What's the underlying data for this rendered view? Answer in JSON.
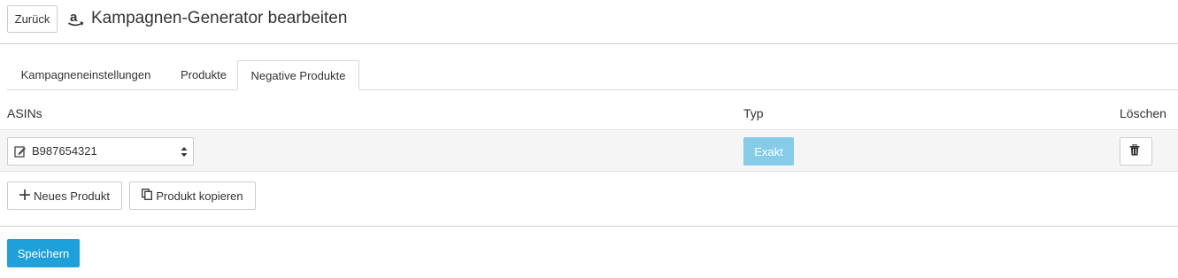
{
  "header": {
    "back_label": "Zurück",
    "title": "Kampagnen-Generator bearbeiten",
    "brand_icon": "amazon-icon"
  },
  "tabs": [
    {
      "label": "Kampagneneinstellungen",
      "active": false
    },
    {
      "label": "Produkte",
      "active": false
    },
    {
      "label": "Negative Produkte",
      "active": true
    }
  ],
  "table": {
    "columns": {
      "asins": "ASINs",
      "type": "Typ",
      "delete": "Löschen"
    },
    "rows": [
      {
        "asin": "B987654321",
        "type": "Exakt"
      }
    ]
  },
  "actions": {
    "new_product": "Neues Produkt",
    "copy_product": "Produkt kopieren",
    "save": "Speichern"
  },
  "colors": {
    "primary": "#1ea1db",
    "type_badge": "#86cce8"
  }
}
